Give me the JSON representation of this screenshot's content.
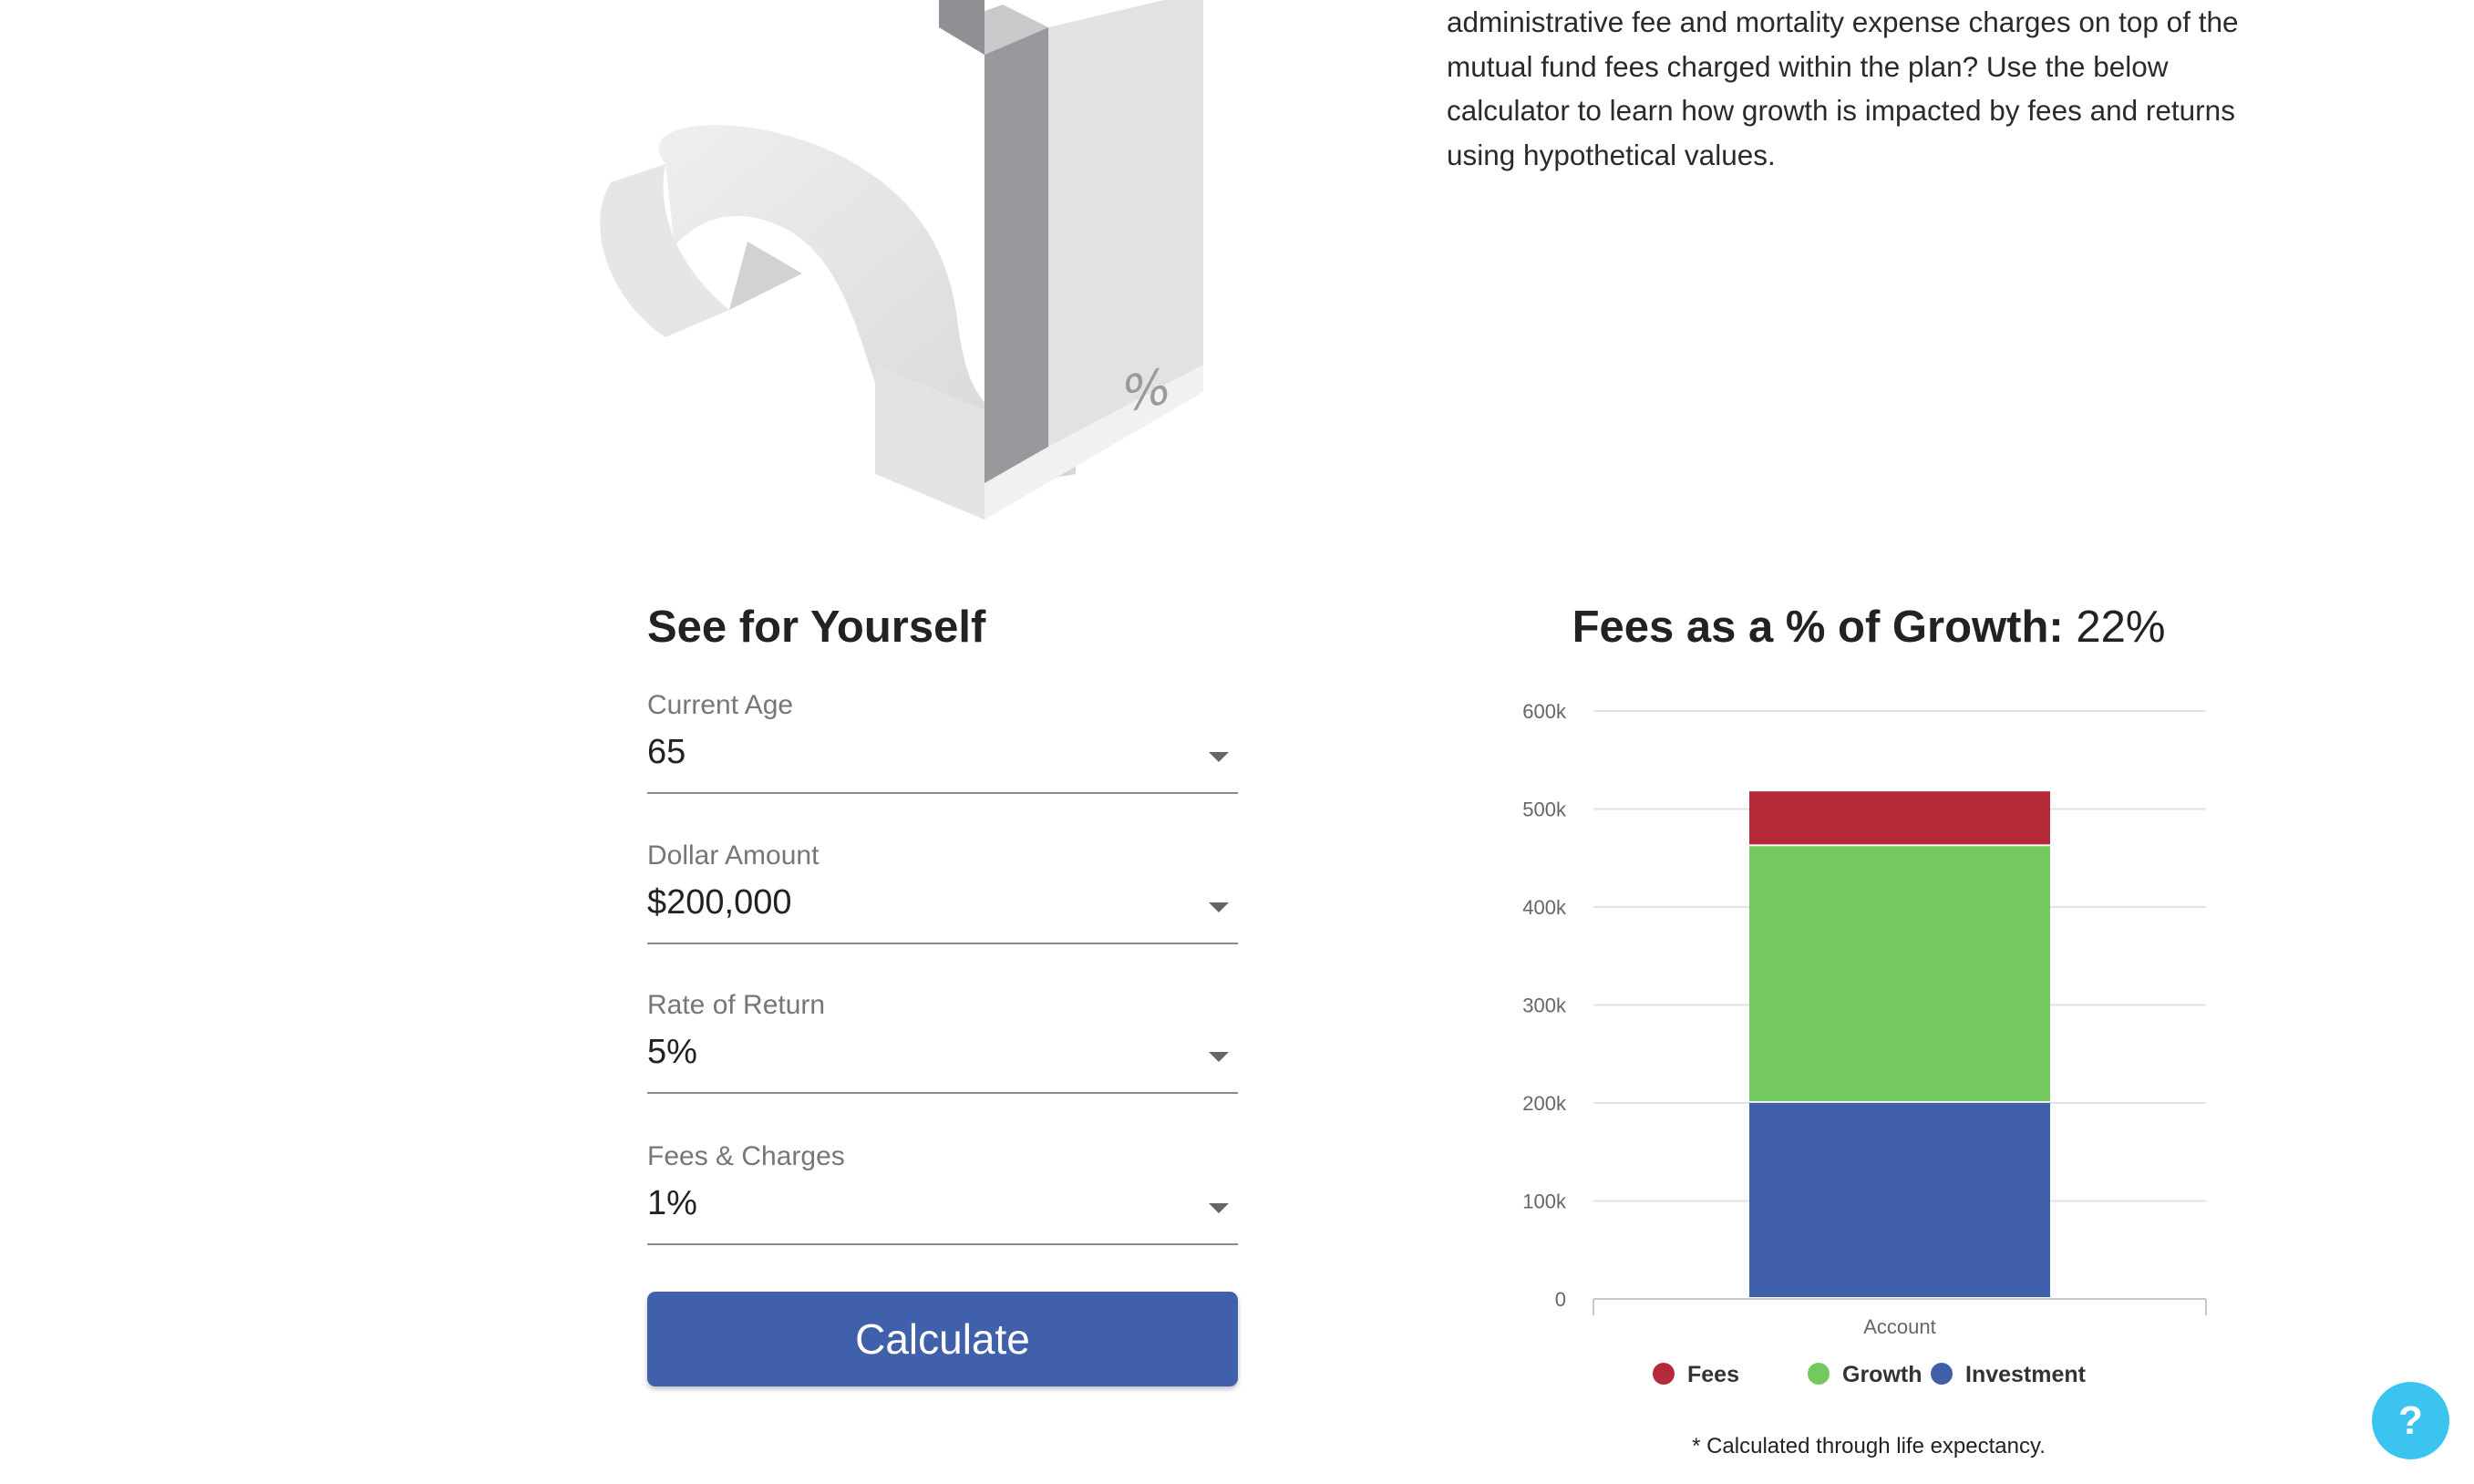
{
  "intro": {
    "lines": [
      "administrative fee and mortality expense charges on top of the",
      "mutual fund fees charged within the plan? Use the below",
      "calculator to learn how growth is impacted by fees and returns",
      "using hypothetical values."
    ]
  },
  "hero": {
    "icon": "percent-sign-3d-illustration",
    "glyph": "%"
  },
  "form": {
    "title": "See for Yourself",
    "fields": [
      {
        "label": "Current Age",
        "value": "65"
      },
      {
        "label": "Dollar Amount",
        "value": "$200,000"
      },
      {
        "label": "Rate of Return",
        "value": "5%"
      },
      {
        "label": "Fees & Charges",
        "value": "1%"
      }
    ],
    "button_label": "Calculate",
    "button_color": "#4160ab"
  },
  "chart": {
    "title_bold": "Fees as a % of Growth:",
    "title_value": "22%",
    "note": "* Calculated through life expectancy."
  },
  "chart_data": {
    "type": "bar",
    "stacked": true,
    "categories": [
      "Account"
    ],
    "series": [
      {
        "name": "Investment",
        "values": [
          200000
        ],
        "color": "#405fab"
      },
      {
        "name": "Growth",
        "values": [
          262000
        ],
        "color": "#73c95d"
      },
      {
        "name": "Fees",
        "values": [
          56000
        ],
        "color": "#b52a39"
      }
    ],
    "ylim": [
      0,
      600000
    ],
    "yticks": [
      0,
      100000,
      200000,
      300000,
      400000,
      500000,
      600000
    ],
    "ytick_labels": [
      "0",
      "100k",
      "200k",
      "300k",
      "400k",
      "500k",
      "600k"
    ],
    "legend_order": [
      "Fees",
      "Growth",
      "Investment"
    ],
    "legend_position": "bottom",
    "grid": true
  },
  "help": {
    "label": "?",
    "color": "#3ac4ef"
  }
}
